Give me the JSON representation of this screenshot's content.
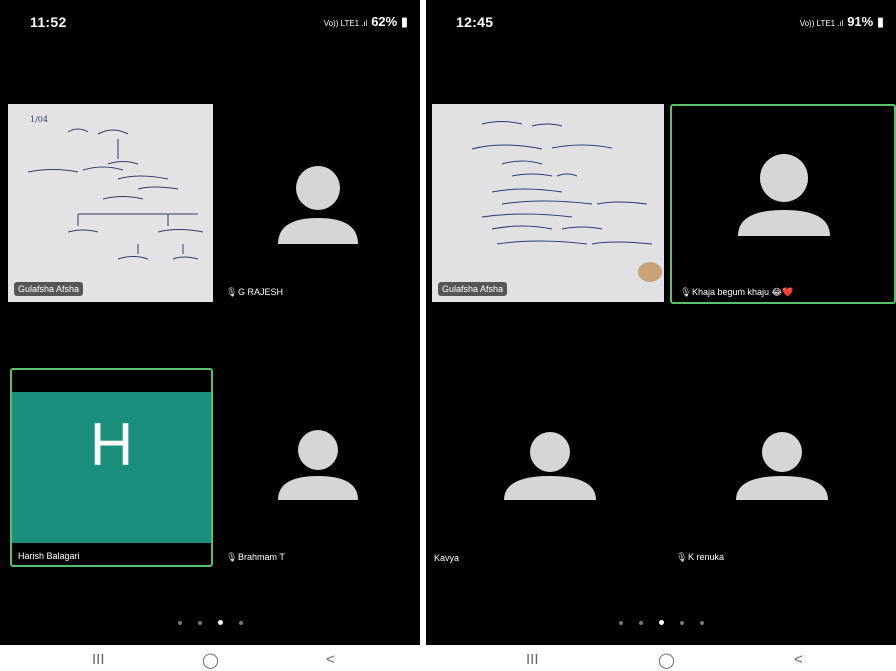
{
  "left": {
    "status": {
      "time": "11:52",
      "battery": "62%",
      "network": "Vo)) LTE1 .ıl"
    },
    "participants": [
      {
        "name": "Gulafsha Afsha"
      },
      {
        "name": "G RAJESH"
      },
      {
        "name": "Harish Balagari",
        "initial": "H"
      },
      {
        "name": "Brahmam T"
      }
    ]
  },
  "right": {
    "status": {
      "time": "12:45",
      "battery": "91%",
      "network": "Vo)) LTE1 .ıl"
    },
    "participants": [
      {
        "name": "Gulafsha Afsha"
      },
      {
        "name": "Khaja begum khaju 😂❤️"
      },
      {
        "name": "Kavya"
      },
      {
        "name": "K renuka"
      }
    ]
  },
  "nav": {
    "recents": "III",
    "home": "◯",
    "back": "<"
  },
  "colors": {
    "active_border": "#5bc06a",
    "tile_h": "#1a8f7d",
    "avatar": "#d6d6d6"
  },
  "icons": [
    "whatsapp-icon",
    "mic-muted-icon",
    "avatar-placeholder-icon",
    "battery-icon"
  ]
}
